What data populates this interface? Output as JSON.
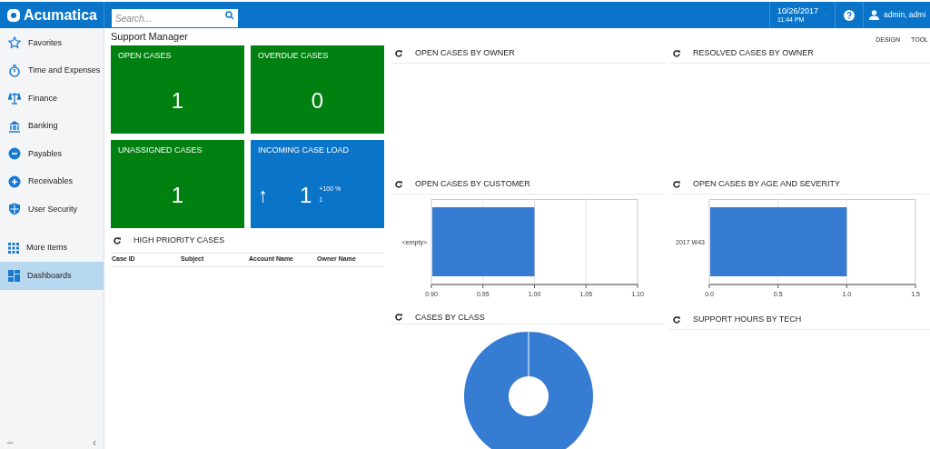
{
  "app": {
    "name": "Acumatica"
  },
  "search": {
    "placeholder": "Search..."
  },
  "topbar": {
    "date": "10/26/2017",
    "time": "11:44 PM",
    "user": "admin, admi"
  },
  "sidebar": {
    "modules": [
      {
        "label": "Favorites",
        "selected": false
      },
      {
        "label": "Time and Expenses",
        "selected": false
      },
      {
        "label": "Finance",
        "selected": false
      },
      {
        "label": "Banking",
        "selected": false
      },
      {
        "label": "Payables",
        "selected": false
      },
      {
        "label": "Receivables",
        "selected": false
      },
      {
        "label": "User Security",
        "selected": false
      }
    ],
    "more": [
      {
        "label": "More Items",
        "selected": false
      },
      {
        "label": "Dashboards",
        "selected": true
      }
    ],
    "footer": {
      "dots": "•••",
      "collapse": "‹"
    }
  },
  "page": {
    "title": "Support Manager",
    "actions": [
      "DESIGN",
      "TOOL"
    ]
  },
  "tiles": [
    {
      "kind": "count",
      "title": "OPEN CASES",
      "value": "1",
      "color": "#008010"
    },
    {
      "kind": "count",
      "title": "OVERDUE CASES",
      "value": "0",
      "color": "#008010"
    },
    {
      "kind": "count",
      "title": "UNASSIGNED CASES",
      "value": "1",
      "color": "#008010"
    },
    {
      "kind": "trend",
      "title": "INCOMING CASE LOAD",
      "arrow": "↑",
      "value": "1",
      "change": "+100 %",
      "previous": "1",
      "color": "#0a74c8"
    }
  ],
  "high_priority": {
    "title": "HIGH PRIORITY CASES",
    "columns": [
      "Case ID",
      "Subject",
      "Account Name",
      "Owner Name"
    ]
  },
  "widgets": [
    {
      "kind": "empty",
      "title": "OPEN CASES BY OWNER"
    },
    {
      "kind": "empty",
      "title": "RESOLVED CASES BY OWNER"
    },
    {
      "kind": "bar",
      "title": "OPEN CASES BY CUSTOMER",
      "chart_data": {
        "type": "bar",
        "orientation": "horizontal",
        "grid": true,
        "categories": [
          "<empty>"
        ],
        "values": [
          1.0
        ],
        "xlim": [
          0.9,
          1.1
        ],
        "xticks": [
          {
            "value": 0.9,
            "label": "0.90"
          },
          {
            "value": 0.95,
            "label": "0.95"
          },
          {
            "value": 1.0,
            "label": "1.00"
          },
          {
            "value": 1.05,
            "label": "1.05"
          },
          {
            "value": 1.1,
            "label": "1.10"
          }
        ]
      }
    },
    {
      "kind": "bar",
      "title": "OPEN CASES BY AGE AND SEVERITY",
      "chart_data": {
        "type": "bar",
        "orientation": "horizontal",
        "grid": true,
        "categories": [
          "2017 W43"
        ],
        "values": [
          1.0
        ],
        "xlim": [
          0,
          1.5
        ],
        "xticks": [
          {
            "value": 0,
            "label": "0.0"
          },
          {
            "value": 0.5,
            "label": "0.5"
          },
          {
            "value": 1.0,
            "label": "1.0"
          },
          {
            "value": 1.5,
            "label": "1.5"
          }
        ]
      }
    },
    {
      "kind": "donut",
      "title": "CASES BY CLASS"
    },
    {
      "kind": "empty",
      "title": "SUPPORT HOURS BY TECH"
    }
  ]
}
